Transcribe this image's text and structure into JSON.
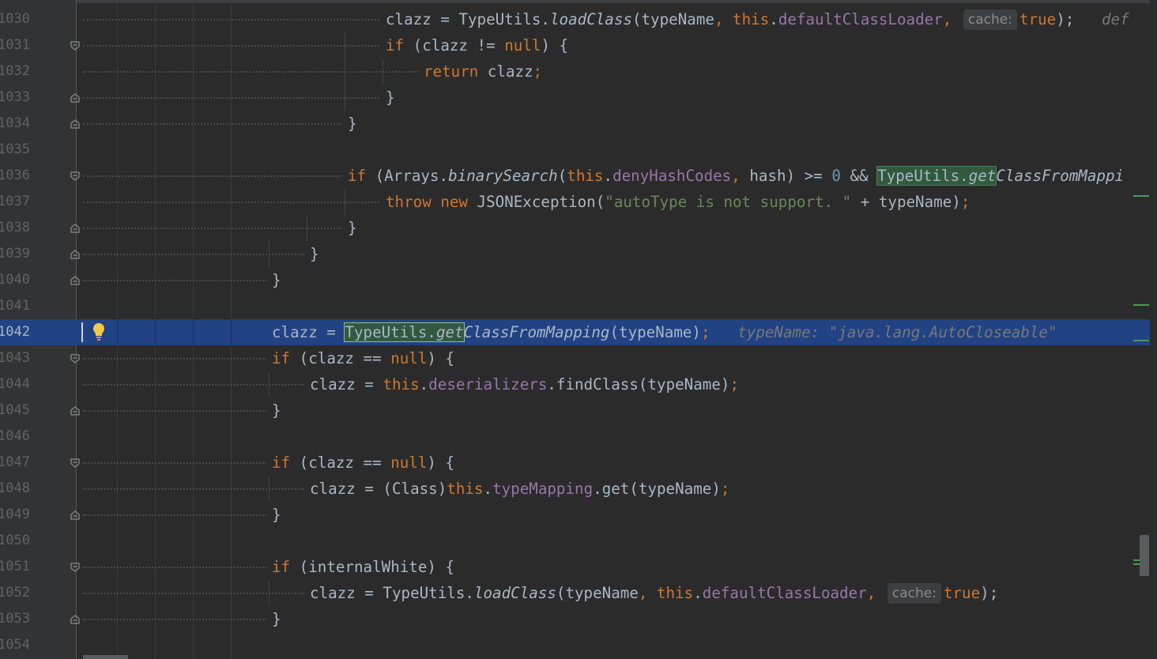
{
  "editor": {
    "current_line_number": "1042",
    "theme_colors": {
      "background": "#2b2b2b",
      "gutter": "#313335",
      "current_line": "#214283",
      "keyword": "#cc7832",
      "field": "#9876aa",
      "string": "#6a8759",
      "number": "#6897bb",
      "match_highlight": "#32593d"
    },
    "lines": [
      {
        "num": "1030",
        "tokens": [
          "clazz",
          "=",
          "TypeUtils.",
          "loadClass",
          "(typeName",
          ",",
          "this",
          ".",
          "defaultClassLoader",
          ",",
          "cache:",
          "true",
          ");",
          "def"
        ]
      },
      {
        "num": "1031",
        "tokens": [
          "if",
          "(clazz",
          "!=",
          "null",
          ") {"
        ]
      },
      {
        "num": "1032",
        "tokens": [
          "return",
          "clazz",
          ";"
        ]
      },
      {
        "num": "1033",
        "tokens": [
          "}"
        ]
      },
      {
        "num": "1034",
        "tokens": [
          "}"
        ]
      },
      {
        "num": "1035",
        "tokens": []
      },
      {
        "num": "1036",
        "tokens": [
          "if",
          "(Arrays.",
          "binarySearch",
          "(",
          "this",
          ".",
          "denyHashCodes",
          ",",
          "hash) >=",
          "0",
          "&&",
          "TypeUtils.",
          "get",
          "ClassFromMappi"
        ]
      },
      {
        "num": "1037",
        "tokens": [
          "throw",
          "new",
          "JSONException(",
          "\"autoType is not support. \"",
          "+ typeName)",
          ";"
        ]
      },
      {
        "num": "1038",
        "tokens": [
          "}"
        ]
      },
      {
        "num": "1039",
        "tokens": [
          "}"
        ]
      },
      {
        "num": "1040",
        "tokens": [
          "}"
        ]
      },
      {
        "num": "1041",
        "tokens": []
      },
      {
        "num": "1042",
        "tokens": [
          "clazz =",
          "TypeUtils.",
          "get",
          "ClassFromMapping",
          "(typeName)",
          ";",
          "typeName: \"java.lang.AutoCloseable\""
        ]
      },
      {
        "num": "1043",
        "tokens": [
          "if",
          "(clazz ==",
          "null",
          ") {"
        ]
      },
      {
        "num": "1044",
        "tokens": [
          "clazz =",
          "this",
          ".",
          "deserializers",
          ".findClass(typeName)",
          ";"
        ]
      },
      {
        "num": "1045",
        "tokens": [
          "}"
        ]
      },
      {
        "num": "1046",
        "tokens": []
      },
      {
        "num": "1047",
        "tokens": [
          "if",
          "(clazz ==",
          "null",
          ") {"
        ]
      },
      {
        "num": "1048",
        "tokens": [
          "clazz = (Class)",
          "this",
          ".",
          "typeMapping",
          ".get(typeName)",
          ";"
        ]
      },
      {
        "num": "1049",
        "tokens": [
          "}"
        ]
      },
      {
        "num": "1050",
        "tokens": []
      },
      {
        "num": "1051",
        "tokens": [
          "if",
          "(internalWhite) {"
        ]
      },
      {
        "num": "1052",
        "tokens": [
          "clazz = TypeUtils.",
          "loadClass",
          "(typeName",
          ",",
          "this",
          ".",
          "defaultClassLoader",
          ",",
          "cache:",
          "true",
          ");"
        ]
      },
      {
        "num": "1053",
        "tokens": [
          "}"
        ]
      },
      {
        "num": "1054",
        "tokens": []
      }
    ]
  }
}
